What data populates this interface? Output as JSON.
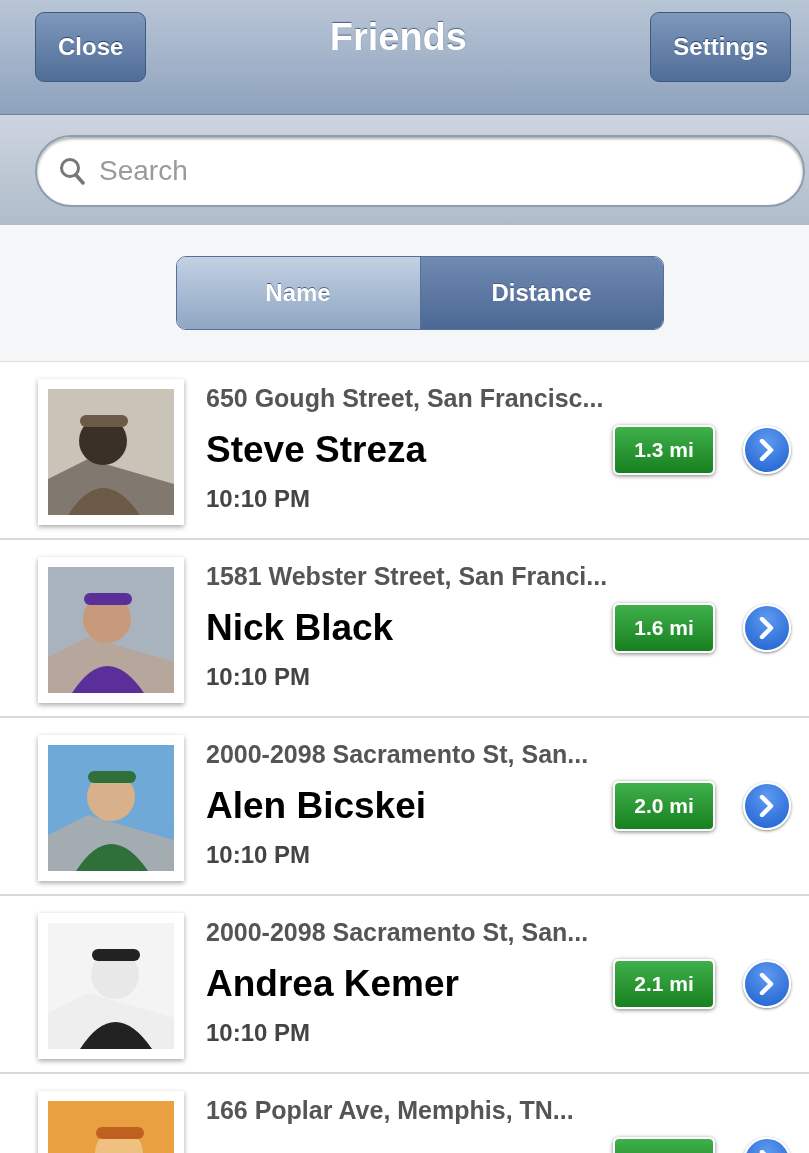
{
  "nav_bar": {
    "title": "Friends",
    "left_button": "Close",
    "right_button": "Settings"
  },
  "search": {
    "placeholder": "Search"
  },
  "sort_control": {
    "segments": [
      {
        "label": "Name",
        "selected": false
      },
      {
        "label": "Distance",
        "selected": true
      }
    ]
  },
  "friends": [
    {
      "address": "650 Gough Street, San Francisc...",
      "name": "Steve Streza",
      "distance": "1.3 mi",
      "time": "10:10 PM"
    },
    {
      "address": "1581 Webster Street, San Franci...",
      "name": "Nick Black",
      "distance": "1.6 mi",
      "time": "10:10 PM"
    },
    {
      "address": "2000-2098 Sacramento St, San...",
      "name": "Alen Bicskei",
      "distance": "2.0 mi",
      "time": "10:10 PM"
    },
    {
      "address": "2000-2098 Sacramento St, San...",
      "name": "Andrea Kemer",
      "distance": "2.1 mi",
      "time": "10:10 PM"
    },
    {
      "address": "166 Poplar Ave, Memphis, TN..."
    }
  ]
}
